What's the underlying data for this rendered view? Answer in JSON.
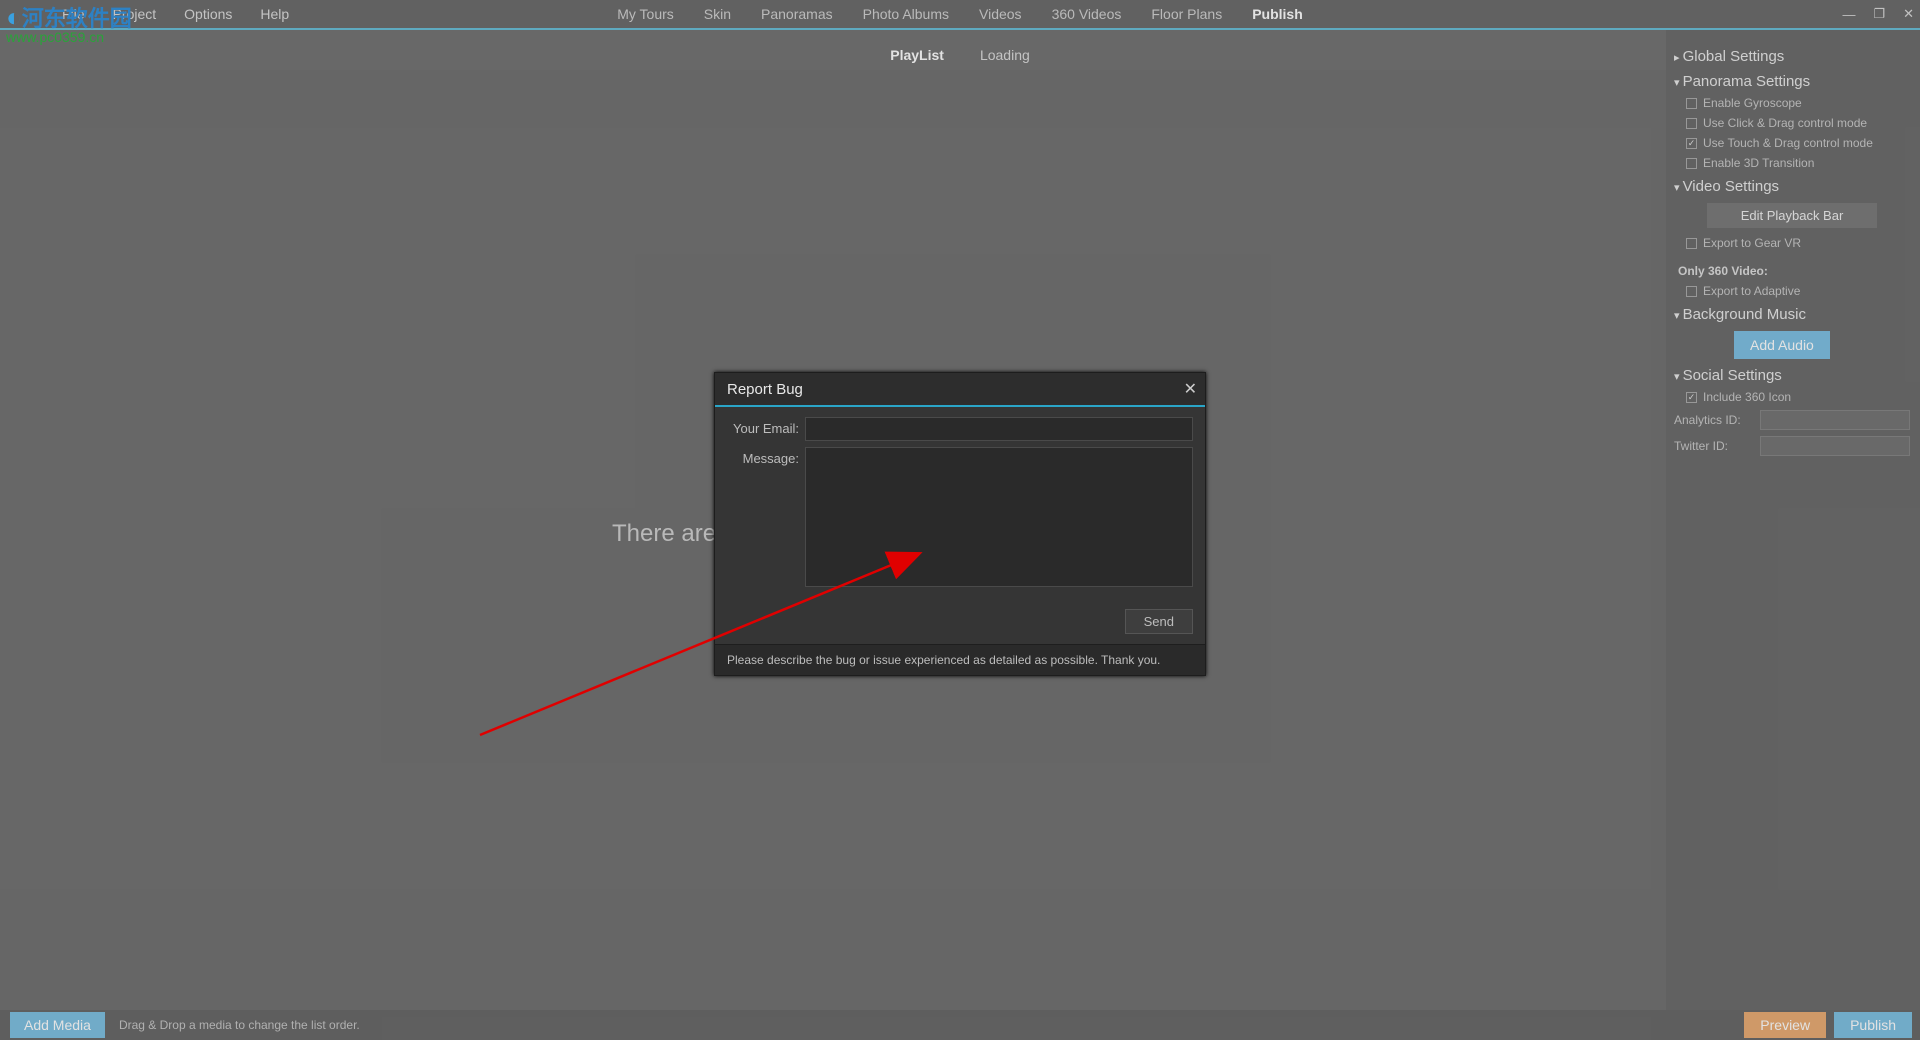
{
  "menu": {
    "file": "File",
    "project": "Project",
    "options": "Options",
    "help": "Help"
  },
  "tabs": {
    "mytours": "My Tours",
    "skin": "Skin",
    "panoramas": "Panoramas",
    "photoalbums": "Photo Albums",
    "videos": "Videos",
    "v360": "360 Videos",
    "floorplans": "Floor Plans",
    "publish": "Publish"
  },
  "subtabs": {
    "playlist": "PlayList",
    "loading": "Loading"
  },
  "canvas": {
    "empty": "There are"
  },
  "sidebar": {
    "global": "Global Settings",
    "panorama": "Panorama Settings",
    "pan_items": {
      "gyro": "Enable Gyroscope",
      "clickdrag": "Use Click & Drag control mode",
      "touchdrag": "Use Touch & Drag control mode",
      "trans3d": "Enable 3D Transition"
    },
    "video": "Video Settings",
    "video_items": {
      "editbar": "Edit Playback Bar",
      "gearvr": "Export to Gear VR",
      "only360": "Only 360 Video:",
      "adaptive": "Export to Adaptive"
    },
    "bgmusic": "Background Music",
    "bgmusic_btn": "Add Audio",
    "social": "Social Settings",
    "social_items": {
      "include360": "Include 360 Icon",
      "analytics": "Analytics ID:",
      "twitter": "Twitter ID:"
    }
  },
  "bottom": {
    "addmedia": "Add Media",
    "hint": "Drag & Drop a media to change the list order.",
    "preview": "Preview",
    "publish": "Publish"
  },
  "modal": {
    "title": "Report Bug",
    "email_label": "Your Email:",
    "message_label": "Message:",
    "send": "Send",
    "footer": "Please describe the bug or issue experienced as detailed as possible. Thank you."
  },
  "watermark": {
    "cn": "河东软件园",
    "url": "www.pc0359.cn"
  }
}
